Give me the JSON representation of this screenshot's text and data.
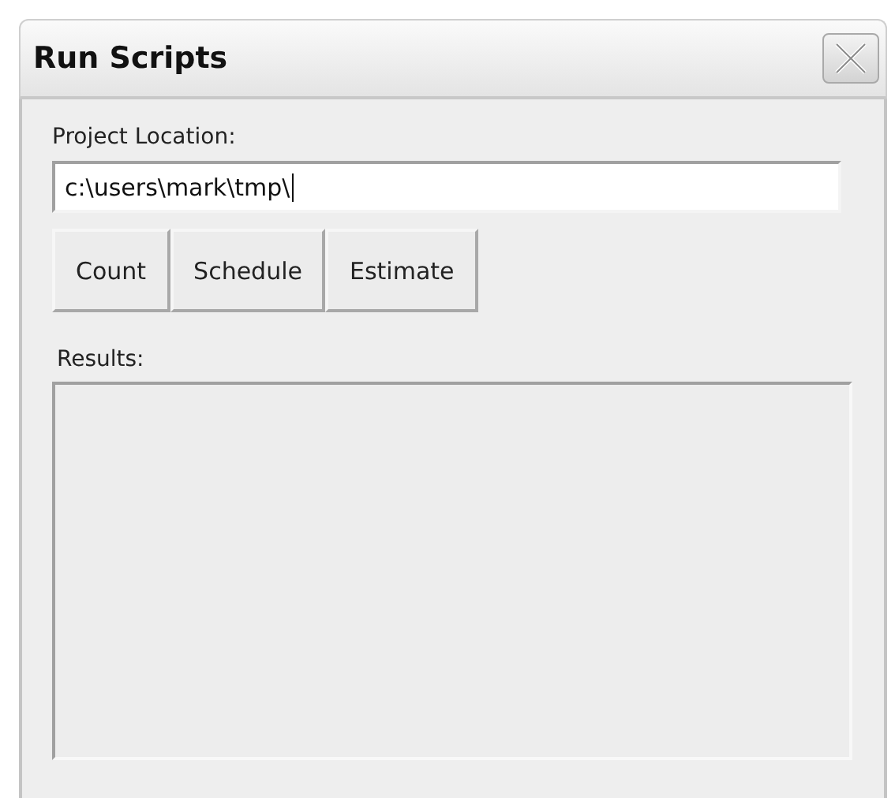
{
  "window": {
    "title": "Run Scripts"
  },
  "project_location": {
    "label": "Project Location:",
    "value": "c:\\users\\mark\\tmp\\",
    "focused": true
  },
  "buttons": [
    "Count",
    "Schedule",
    "Estimate"
  ],
  "results": {
    "label": "Results:"
  }
}
